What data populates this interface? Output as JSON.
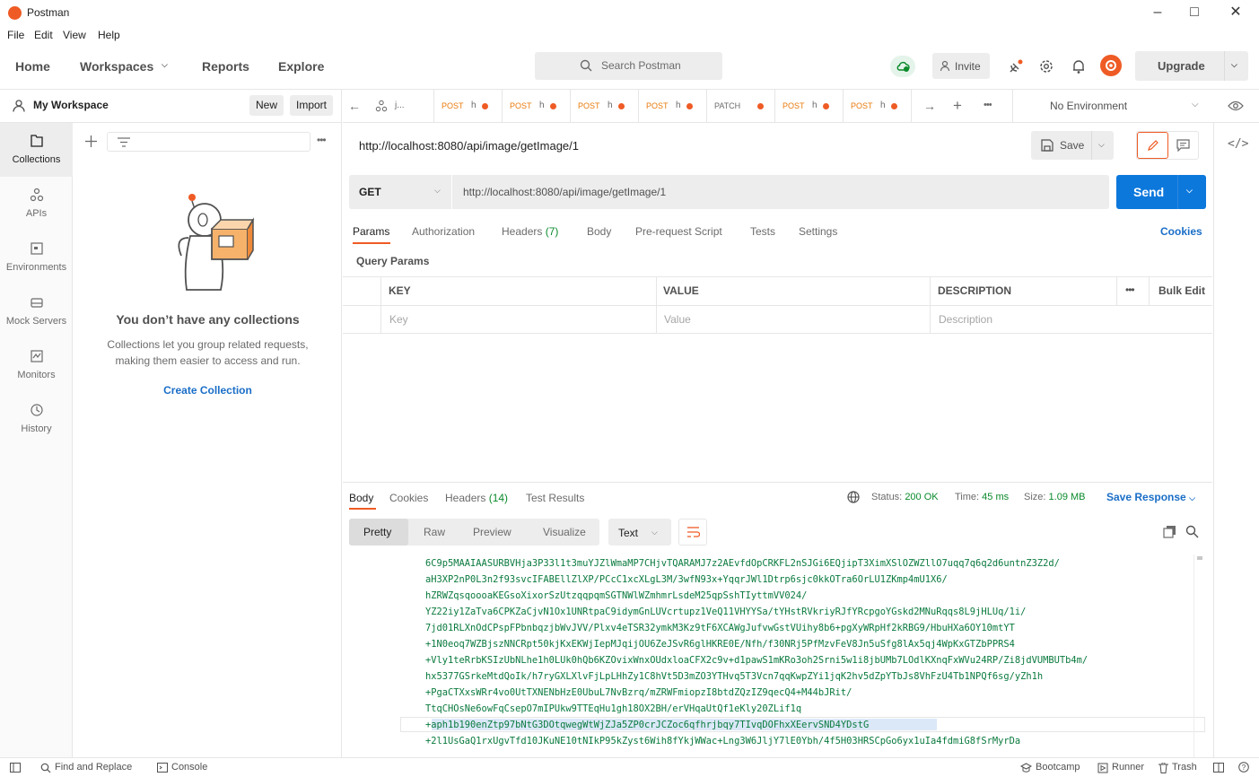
{
  "window": {
    "title": "Postman"
  },
  "menu": [
    "File",
    "Edit",
    "View",
    "Help"
  ],
  "header": {
    "nav": [
      "Home",
      "Workspaces",
      "Reports",
      "Explore"
    ],
    "search_placeholder": "Search Postman",
    "invite": "Invite",
    "upgrade": "Upgrade"
  },
  "workspace": {
    "name": "My Workspace",
    "new": "New",
    "import": "Import"
  },
  "rail": [
    "Collections",
    "APIs",
    "Environments",
    "Mock Servers",
    "Monitors",
    "History"
  ],
  "sidebar": {
    "empty_title": "You don’t have any collections",
    "empty_desc": "Collections let you group related requests, making them easier to access and run.",
    "create": "Create Collection"
  },
  "tabs": [
    {
      "method": "",
      "title": "j..."
    },
    {
      "method": "POST",
      "title": "h"
    },
    {
      "method": "POST",
      "title": "h"
    },
    {
      "method": "POST",
      "title": "h"
    },
    {
      "method": "POST",
      "title": "h"
    },
    {
      "method": "PATCH",
      "title": ""
    },
    {
      "method": "POST",
      "title": "h"
    },
    {
      "method": "POST",
      "title": "h"
    }
  ],
  "environment": "No Environment",
  "request": {
    "title": "http://localhost:8080/api/image/getImage/1",
    "save": "Save",
    "method": "GET",
    "url": "http://localhost:8080/api/image/getImage/1",
    "send": "Send",
    "tabs": [
      "Params",
      "Authorization",
      "Headers",
      "Body",
      "Pre-request Script",
      "Tests",
      "Settings"
    ],
    "headers_count": "(7)",
    "cookies": "Cookies",
    "query_params": "Query Params",
    "columns": [
      "KEY",
      "VALUE",
      "DESCRIPTION"
    ],
    "bulk_edit": "Bulk Edit",
    "placeholders": [
      "Key",
      "Value",
      "Description"
    ]
  },
  "response": {
    "tabs": [
      "Body",
      "Cookies",
      "Headers",
      "Test Results"
    ],
    "headers_count": "(14)",
    "status_label": "Status:",
    "status": "200 OK",
    "time_label": "Time:",
    "time": "45 ms",
    "size_label": "Size:",
    "size": "1.09 MB",
    "save_response": "Save Response",
    "views": [
      "Pretty",
      "Raw",
      "Preview",
      "Visualize"
    ],
    "format": "Text",
    "lines": [
      "6C9p5MAAIAASURBVHja3P33l1t3muYJZlWmaMP7CHjvTQARAMJ7z2AEvfdOpCRKFL2nSJGi6EQjipT3XimXSlOZWZllO7uqq7q6q2d6untnZ3Z2d/",
      "aH3XP2nP0L3n2f93svcIFABEllZlXP/PCcC1xcXLgL3M/3wfN93x+YqqrJWl1Dtrp6sjc0kkOTra6OrLU1ZKmp4mU1X6/",
      "hZRWZqsqoooaKEGsoXixorSzUtzqqpqmSGTNWlWZmhmrLsdeM25qpSshTIyttmVV024/",
      "YZ22iy1ZaTva6CPKZaCjvN1Ox1UNRtpaC9idymGnLUVcrtupz1VeQ11VHYYSa/tYHstRVkriyRJfYRcpgoYGskd2MNuRqqs8L9jHLUq/1i/",
      "7jd01RLXnOdCPspFPbnbqzjbWvJVV/Plxv4eTSR32ymkM3Kz9tF6XCAWgJufvwGstVUihy8b6+pgXyWRpHf2kRBG9/HbuHXa6OY10mtYT",
      "+1N0eoq7WZBjszNNCRpt50kjKxEKWjIepMJqijOU6ZeJSvR6glHKRE0E/Nfh/f30NRj5PfMzvFeV8Jn5uSfg8lAx5qj4WpKxGTZbPPRS4",
      "+Vly1teRrbKSIzUbNLhe1h0LUk0hQb6KZOvixWnxOUdxloaCFX2c9v+d1pawS1mKRo3oh2Srni5w1i8jbUMb7LOdlKXnqFxWVu24RP/Zi8jdVUMBUTb4m/",
      "hx5377GSrkeMtdQoIk/h7ryGXLXlvFjLpLHhZy1C8hVt5D3mZO3YTHvq5T3Vcn7qqKwpZYi1jqK2hv5dZpYTbJs8VhFzU4Tb1NPQf6sg/yZh1h",
      "+PgaCTXxsWRr4vo0UtTXNENbHzE0UbuL7NvBzrq/mZRWFmiopzI8btdZQzIZ9qecQ4+M44bJRit/",
      "TtqCHOsNe6owFqCsepO7mIPUkw9TTEqHu1gh18OX2BH/erVHqaUtQf1eKly20ZLif1q",
      "+aph1b190enZtp97bNtG3DOtqwegWtWjZJa5ZP0crJCZoc6qfhrjbqy7TIvqDOFhxXEervSND4YDstG",
      "+2l1UsGaQ1rxUgvTfd10JKuNE10tNIkP95kZyst6Wih8fYkjWWac+Lng3W6JljY7lE0Ybh/4f5H03HRSCpGo6yx1uIa4fdmiG8fSrMyrDa"
    ]
  },
  "statusbar": {
    "find_replace": "Find and Replace",
    "console": "Console",
    "bootcamp": "Bootcamp",
    "runner": "Runner",
    "trash": "Trash"
  }
}
